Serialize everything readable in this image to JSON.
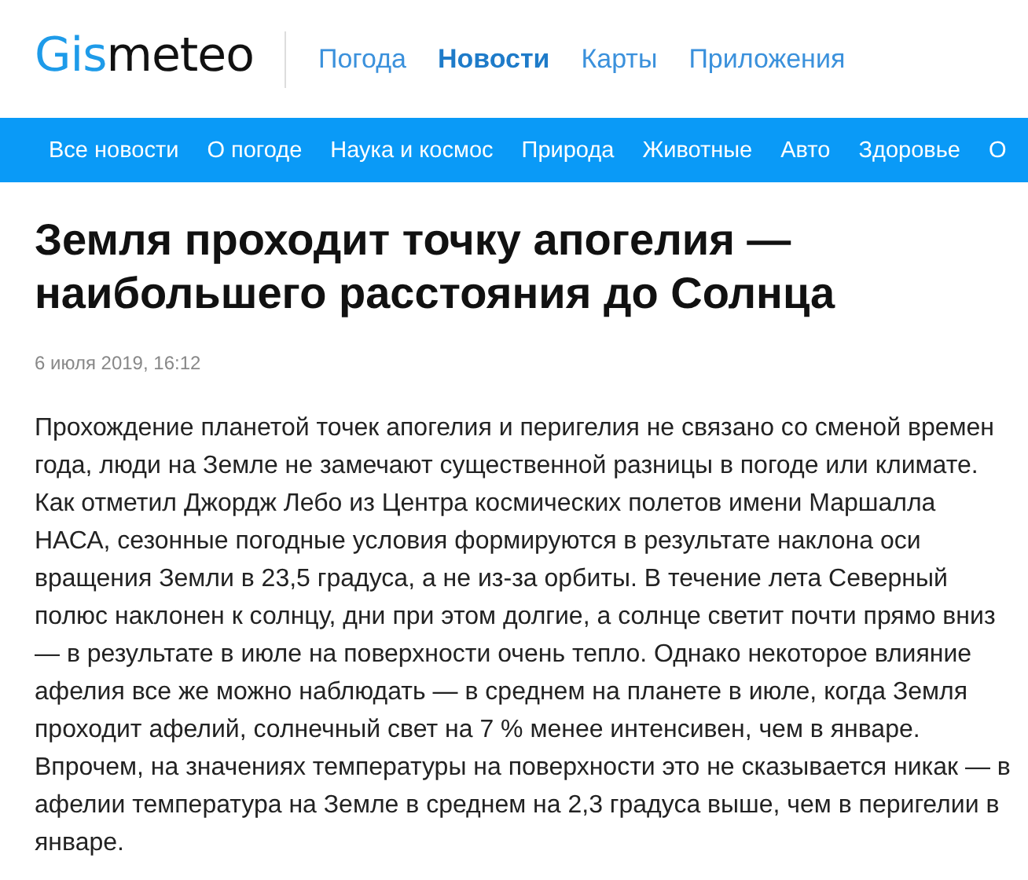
{
  "logo": {
    "accent": "Gis",
    "rest": "meteo"
  },
  "nav": [
    {
      "label": "Погода",
      "selected": false
    },
    {
      "label": "Новости",
      "selected": true
    },
    {
      "label": "Карты",
      "selected": false
    },
    {
      "label": "Приложения",
      "selected": false
    }
  ],
  "categories": [
    "Все новости",
    "О погоде",
    "Наука и космос",
    "Природа",
    "Животные",
    "Авто",
    "Здоровье",
    "О"
  ],
  "article": {
    "title": "Земля проходит точку апогелия — наибольшего расстояния до Солнца",
    "date": "6 июля 2019, 16:12",
    "body": "Прохождение планетой точек апогелия и перигелия не связано со сменой времен года, люди на Земле не замечают существенной разницы в погоде или климате. Как отметил Джордж Лебо из Центра космических полетов имени Маршалла НАСА, сезонные погодные условия формируются в результате наклона оси вращения Земли в 23,5 градуса, а не из-за орбиты. В течение лета Северный полюс наклонен к солнцу, дни при этом долгие, а солнце светит почти прямо вниз — в результате в июле на поверхности очень тепло. Однако некоторое влияние афелия все же можно наблюдать — в среднем на планете в июле, когда Земля проходит афелий, солнечный свет на 7 % менее интенсивен, чем в январе. Впрочем, на значениях температуры на поверхности это не сказывается никак — в афелии температура на Земле в среднем на 2,3 градуса выше, чем в перигелии в январе."
  }
}
